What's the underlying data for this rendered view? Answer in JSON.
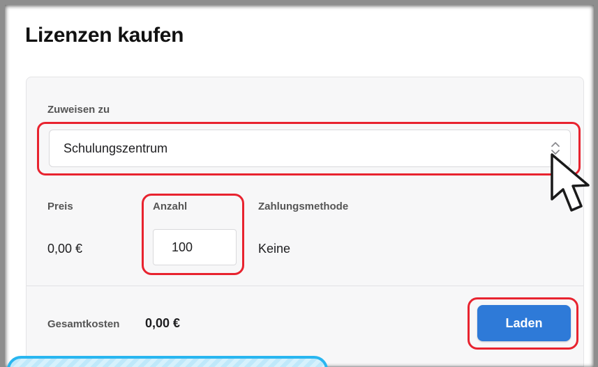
{
  "page": {
    "title": "Lizenzen kaufen"
  },
  "assign": {
    "label": "Zuweisen zu",
    "value": "Schulungszentrum",
    "chevron_icon": "up-down-chevron-icon"
  },
  "details": {
    "price_label": "Preis",
    "price_value": "0,00 €",
    "quantity_label": "Anzahl",
    "quantity_value": "100",
    "payment_label": "Zahlungsmethode",
    "payment_value": "Keine"
  },
  "footer": {
    "total_label": "Gesamtkosten",
    "total_value": "0,00 €",
    "load_button": "Laden"
  },
  "colors": {
    "accent": "#2e7ad8",
    "highlight": "#e8232f",
    "hatch": "#29b6f0"
  }
}
